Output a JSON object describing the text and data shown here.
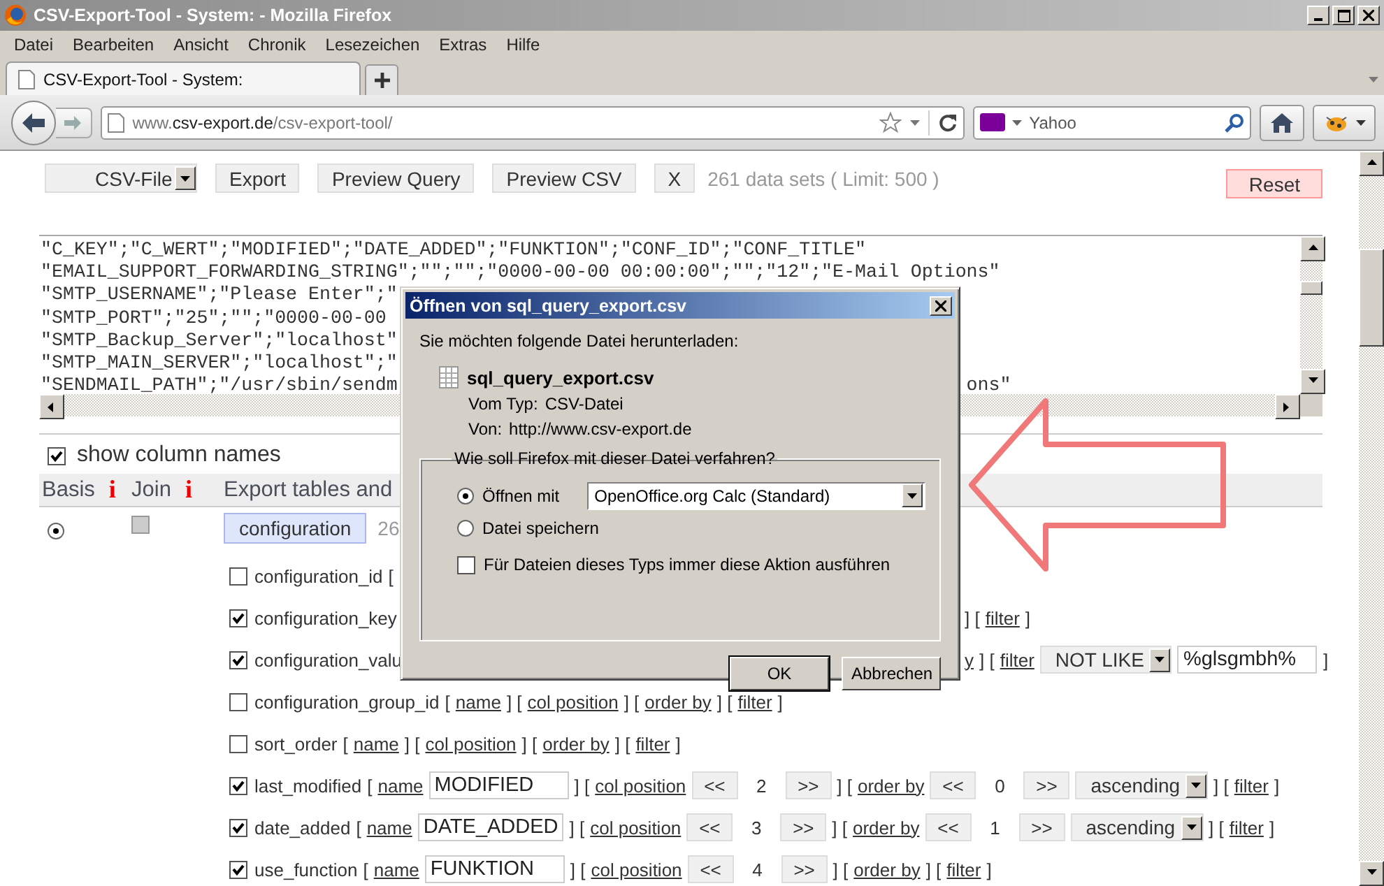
{
  "window": {
    "title": "CSV-Export-Tool - System: - Mozilla Firefox"
  },
  "menu": [
    "Datei",
    "Bearbeiten",
    "Ansicht",
    "Chronik",
    "Lesezeichen",
    "Extras",
    "Hilfe"
  ],
  "tabs": [
    {
      "label": "CSV-Export-Tool - System:",
      "selected": true
    }
  ],
  "url": {
    "prefix": "www.",
    "domain": "csv-export.de",
    "path": "/csv-export-tool/"
  },
  "search": {
    "placeholder": "Yahoo"
  },
  "toolbar": {
    "format": "CSV-File",
    "buttons": [
      "Export",
      "Preview Query",
      "Preview CSV",
      "X"
    ],
    "info": "261 data sets ( Limit: 500 )",
    "reset": "Reset"
  },
  "csv_lines": [
    {
      "text": "\"C_KEY\";\"C_WERT\";\"MODIFIED\";\"DATE_ADDED\";\"FUNKTION\";\"CONF_ID\";\"CONF_TITLE\""
    },
    {
      "text": "\"EMAIL_SUPPORT_FORWARDING_STRING\";\"\";\"\";\"0000-00-00 00:00:00\";\"\";\"12\";\"E-Mail Options\""
    },
    {
      "text": "\"SMTP_USERNAME\";\"Please Enter\";\""
    },
    {
      "text": "\"SMTP_PORT\";\"25\";\"\";\"0000-00-00"
    },
    {
      "text": "\"SMTP_Backup_Server\";\"localhost\""
    },
    {
      "text": "\"SMTP_MAIN_SERVER\";\"localhost\";\""
    },
    {
      "text": "\"SENDMAIL_PATH\";\"/usr/sbin/sendm",
      "tail": "ons\""
    }
  ],
  "show_column_names": {
    "label": "show column names",
    "checked": true
  },
  "header": [
    {
      "label": "Basis",
      "info": "i"
    },
    {
      "label": "Join",
      "info": "i"
    },
    {
      "label": "Export tables and"
    }
  ],
  "table": {
    "basis_selected": true,
    "join_checked": false,
    "join_disabled": true,
    "name": "configuration",
    "count": "26"
  },
  "fields": [
    {
      "label": "configuration_id",
      "checked": false,
      "segments": [
        {
          "kind": "text",
          "text": "["
        }
      ]
    },
    {
      "label": "configuration_key",
      "checked": true,
      "tail": [
        {
          "kind": "text",
          "text": "] ["
        },
        {
          "kind": "link",
          "text": "filter"
        },
        {
          "kind": "text",
          "text": "]"
        }
      ]
    },
    {
      "label": "configuration_valu",
      "checked": true,
      "tail": [
        {
          "kind": "link",
          "text": "y"
        },
        {
          "kind": "text",
          "text": "] ["
        },
        {
          "kind": "link",
          "text": "filter"
        },
        {
          "kind": "select",
          "value": "NOT LIKE"
        },
        {
          "kind": "input",
          "value": "%glsgmbh%"
        },
        {
          "kind": "text",
          "text": "]"
        }
      ]
    },
    {
      "label": "configuration_group_id",
      "checked": false,
      "segments": [
        {
          "kind": "text",
          "text": "["
        },
        {
          "kind": "link",
          "text": "name"
        },
        {
          "kind": "text",
          "text": "] ["
        },
        {
          "kind": "link",
          "text": "col position"
        },
        {
          "kind": "text",
          "text": "] ["
        },
        {
          "kind": "link",
          "text": "order by"
        },
        {
          "kind": "text",
          "text": "] ["
        },
        {
          "kind": "link",
          "text": "filter"
        },
        {
          "kind": "text",
          "text": "]"
        }
      ]
    },
    {
      "label": "sort_order",
      "checked": false,
      "segments": [
        {
          "kind": "text",
          "text": "["
        },
        {
          "kind": "link",
          "text": "name"
        },
        {
          "kind": "text",
          "text": "] ["
        },
        {
          "kind": "link",
          "text": "col position"
        },
        {
          "kind": "text",
          "text": "] ["
        },
        {
          "kind": "link",
          "text": "order by"
        },
        {
          "kind": "text",
          "text": "] ["
        },
        {
          "kind": "link",
          "text": "filter"
        },
        {
          "kind": "text",
          "text": "]"
        }
      ]
    },
    {
      "label": "last_modified",
      "checked": true,
      "segments": [
        {
          "kind": "text",
          "text": "["
        },
        {
          "kind": "link",
          "text": "name"
        },
        {
          "kind": "input",
          "value": "MODIFIED"
        },
        {
          "kind": "text",
          "text": "] ["
        },
        {
          "kind": "link",
          "text": "col position"
        },
        {
          "kind": "stepper",
          "prev": "<<",
          "value": "2",
          "next": ">>"
        },
        {
          "kind": "text",
          "text": "] ["
        },
        {
          "kind": "link",
          "text": "order by"
        },
        {
          "kind": "stepper",
          "prev": "<<",
          "value": "0",
          "next": ">>"
        },
        {
          "kind": "select",
          "value": "ascending"
        },
        {
          "kind": "text",
          "text": "] ["
        },
        {
          "kind": "link",
          "text": "filter"
        },
        {
          "kind": "text",
          "text": "]"
        }
      ]
    },
    {
      "label": "date_added",
      "checked": true,
      "segments": [
        {
          "kind": "text",
          "text": "["
        },
        {
          "kind": "link",
          "text": "name"
        },
        {
          "kind": "input",
          "value": "DATE_ADDED"
        },
        {
          "kind": "text",
          "text": "] ["
        },
        {
          "kind": "link",
          "text": "col position"
        },
        {
          "kind": "stepper",
          "prev": "<<",
          "value": "3",
          "next": ">>"
        },
        {
          "kind": "text",
          "text": "] ["
        },
        {
          "kind": "link",
          "text": "order by"
        },
        {
          "kind": "stepper",
          "prev": "<<",
          "value": "1",
          "next": ">>"
        },
        {
          "kind": "select",
          "value": "ascending"
        },
        {
          "kind": "text",
          "text": "] ["
        },
        {
          "kind": "link",
          "text": "filter"
        },
        {
          "kind": "text",
          "text": "]"
        }
      ]
    },
    {
      "label": "use_function",
      "checked": true,
      "segments": [
        {
          "kind": "text",
          "text": "["
        },
        {
          "kind": "link",
          "text": "name"
        },
        {
          "kind": "input",
          "value": "FUNKTION"
        },
        {
          "kind": "text",
          "text": "] ["
        },
        {
          "kind": "link",
          "text": "col position"
        },
        {
          "kind": "stepper",
          "prev": "<<",
          "value": "4",
          "next": ">>"
        },
        {
          "kind": "text",
          "text": "] ["
        },
        {
          "kind": "link",
          "text": "order by"
        },
        {
          "kind": "text",
          "text": "] ["
        },
        {
          "kind": "link",
          "text": "filter"
        },
        {
          "kind": "text",
          "text": "]"
        }
      ]
    }
  ],
  "dialog": {
    "title": "Öffnen von sql_query_export.csv",
    "intro": "Sie möchten folgende Datei herunterladen:",
    "filename": "sql_query_export.csv",
    "details": [
      {
        "label": "Vom Typ:",
        "value": "CSV-Datei"
      },
      {
        "label": "Von:",
        "value": "http://www.csv-export.de"
      }
    ],
    "legend": "Wie soll Firefox mit dieser Datei verfahren?",
    "options": [
      {
        "label": "Öffnen mit",
        "selected": true,
        "application": "OpenOffice.org Calc (Standard)"
      },
      {
        "label": "Datei speichern",
        "selected": false
      }
    ],
    "remember": {
      "label": "Für Dateien dieses Typs immer diese Aktion ausführen",
      "checked": false
    },
    "buttons": [
      {
        "label": "OK",
        "default": true
      },
      {
        "label": "Abbrechen",
        "default": false
      }
    ]
  }
}
